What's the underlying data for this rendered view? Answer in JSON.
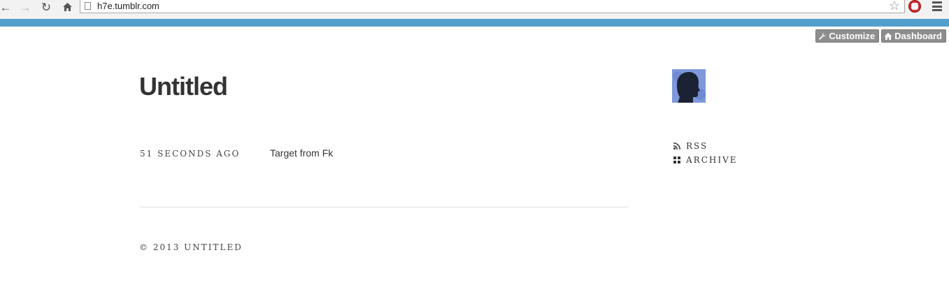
{
  "browser": {
    "url": "h7e.tumblr.com",
    "back_icon": "arrow-left-icon",
    "forward_icon": "arrow-right-icon",
    "reload_icon": "reload-icon",
    "home_icon": "home-icon",
    "accent_color": "#529ecc"
  },
  "tumblr_controls": {
    "customize_label": "Customize",
    "dashboard_label": "Dashboard"
  },
  "blog": {
    "title": "Untitled"
  },
  "post": {
    "time": "51 SECONDS AGO",
    "body": "Target from Fk"
  },
  "sidebar": {
    "links": [
      {
        "label": "RSS",
        "icon": "rss-icon"
      },
      {
        "label": "ARCHIVE",
        "icon": "grid-icon"
      }
    ]
  },
  "footer": {
    "copyright": "© 2013 UNTITLED"
  }
}
